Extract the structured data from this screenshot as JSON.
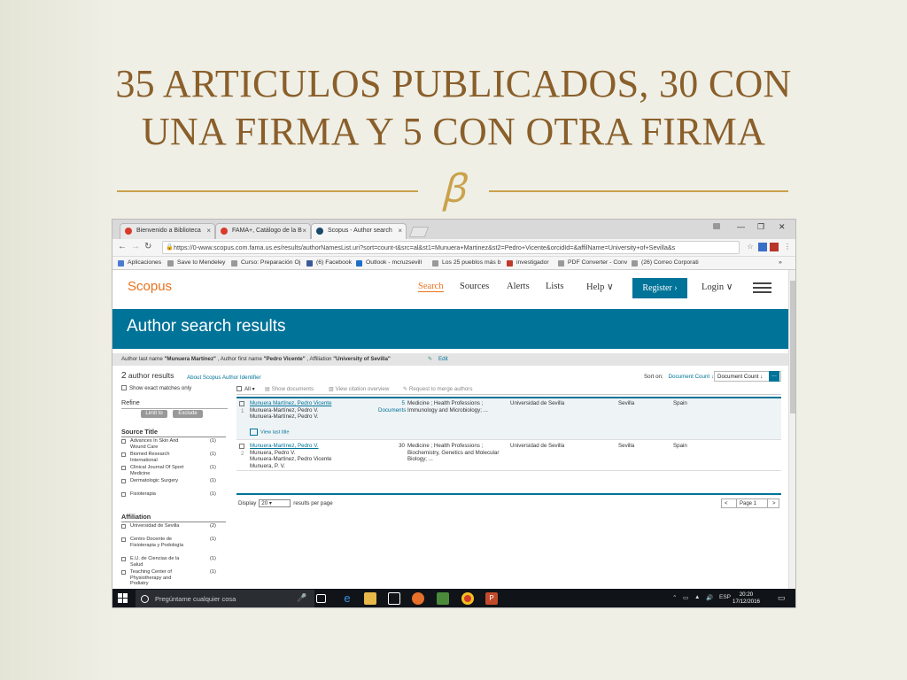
{
  "slide": {
    "title_line1": "35 ARTICULOS PUBLICADOS, 30 CON",
    "title_line2": "UNA FIRMA Y 5 CON OTRA FIRMA",
    "ornament": "𝓑"
  },
  "browser": {
    "tabs": [
      {
        "label": "Bienvenido a Biblioteca",
        "color": "#d83b2b"
      },
      {
        "label": "FAMA+, Catálogo de la B",
        "color": "#d83b2b"
      },
      {
        "label": "Scopus - Author search",
        "color": "#1a4a6a"
      }
    ],
    "window_controls": [
      "—",
      "❐",
      "✕"
    ],
    "url": "https://0-www.scopus.com.fama.us.es/results/authorNamesList.uri?sort=count-t&src=al&st1=Munuera+Martinez&st2=Pedro+Vicente&orcidId=&affilName=University+of+Sevilla&s",
    "bookmarks": [
      {
        "label": "Aplicaciones",
        "color": "#4a7bd0"
      },
      {
        "label": "Save to Mendeley",
        "color": "#888888"
      },
      {
        "label": "Curso: Preparación Oj",
        "color": "#888888"
      },
      {
        "label": "(6) Facebook",
        "color": "#3b5998"
      },
      {
        "label": "Outlook - mcruzsevill",
        "color": "#1e6fc9"
      },
      {
        "label": "Los 25 pueblos más b",
        "color": "#888888"
      },
      {
        "label": "investigador",
        "color": "#c0392b"
      },
      {
        "label": "PDF Converter - Conv",
        "color": "#888888"
      },
      {
        "label": "(26) Correo Corporati",
        "color": "#888888"
      }
    ],
    "more": "»"
  },
  "scopus": {
    "logo": "Scopus",
    "nav": [
      "Search",
      "Sources",
      "Alerts",
      "Lists",
      "Help ∨"
    ],
    "register": "Register ›",
    "login": "Login ∨",
    "banner_title": "Author search results",
    "query": {
      "part1_label": "Author last name ",
      "part1_value": "\"Munuera Martínez\"",
      "part2_label": " , Author first name ",
      "part2_value": "\"Pedro Vicente\"",
      "part3_label": " , Affiliation ",
      "part3_value": "\"University of Sevilla\"",
      "edit": "Edit"
    },
    "count_number": "2",
    "count_text": " author results",
    "about": "About Scopus Author Identifier",
    "sort_label": "Sort on:",
    "sort_link": "Document Count ↓",
    "sort_select": "Document Count ↓",
    "sort_go": "...",
    "sidebar": {
      "exact": "Show exact matches only",
      "refine": "Refine",
      "limit": "Limit to",
      "exclude": "Exclude",
      "source_title_head": "Source Title",
      "source_titles": [
        {
          "label": "Advances In Skin And Wound Care",
          "count": "(1)"
        },
        {
          "label": "Biomed Research International",
          "count": "(1)"
        },
        {
          "label": "Clinical Journal Of Sport Medicine",
          "count": "(1)"
        },
        {
          "label": "Dermatologic Surgery",
          "count": "(1)"
        },
        {
          "label": "Fisioterapia",
          "count": "(1)"
        }
      ],
      "affiliation_head": "Affiliation",
      "affiliations": [
        {
          "label": "Universidad de Sevilla",
          "count": "(2)"
        },
        {
          "label": "Centro Docente de Fisioterapia y Podología",
          "count": "(1)"
        },
        {
          "label": "E.U. de Ciencias de la Salud",
          "count": "(1)"
        },
        {
          "label": "Teaching Center of Physiotherapy and Podiatry",
          "count": "(1)"
        }
      ]
    },
    "toolbar": {
      "all": "All ▾",
      "show_docs": "Show documents",
      "view_citation": "View citation overview",
      "request_merge": "Request to merge authors"
    },
    "results": [
      {
        "index": "1",
        "name": "Munuera Martínez, Pedro Vicente",
        "variants": [
          "Munuera-Martínez, Pedro V.",
          "Munuera-Martínez, Pedro V."
        ],
        "docs": "5",
        "docs_label": "Documents",
        "subjects": "Medicine ; Health Professions ; Immunology and Microbiology; ...",
        "affiliation": "Universidad de Sevilla",
        "city": "Sevilla",
        "country": "Spain",
        "view_last": "View last title"
      },
      {
        "index": "2",
        "name": "Munuera-Martínez, Pedro V.",
        "variants": [
          "Munuera, Pedro V.",
          "Munuera-Martinez, Pedro Vicente",
          "Munuera, P. V."
        ],
        "docs": "30",
        "subjects": "Medicine ; Health Professions ; Biochemistry, Genetics and Molecular Biology; ...",
        "affiliation": "Universidad de Sevilla",
        "city": "Sevilla",
        "country": "Spain"
      }
    ],
    "display_label": "Display",
    "display_value": "20",
    "per_page": "results per page",
    "page": "Page 1"
  },
  "taskbar": {
    "search_placeholder": "Pregúntame cualquier cosa",
    "lang": "ESP",
    "time": "20:20",
    "date": "17/12/2016"
  }
}
